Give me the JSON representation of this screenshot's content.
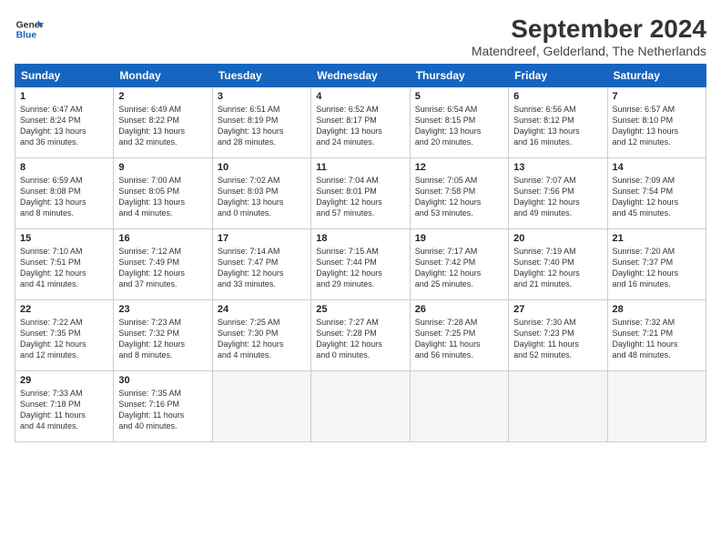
{
  "logo": {
    "line1": "General",
    "line2": "Blue"
  },
  "title": "September 2024",
  "subtitle": "Matendreef, Gelderland, The Netherlands",
  "headers": [
    "Sunday",
    "Monday",
    "Tuesday",
    "Wednesday",
    "Thursday",
    "Friday",
    "Saturday"
  ],
  "weeks": [
    [
      {
        "day": "1",
        "info": "Sunrise: 6:47 AM\nSunset: 8:24 PM\nDaylight: 13 hours\nand 36 minutes."
      },
      {
        "day": "2",
        "info": "Sunrise: 6:49 AM\nSunset: 8:22 PM\nDaylight: 13 hours\nand 32 minutes."
      },
      {
        "day": "3",
        "info": "Sunrise: 6:51 AM\nSunset: 8:19 PM\nDaylight: 13 hours\nand 28 minutes."
      },
      {
        "day": "4",
        "info": "Sunrise: 6:52 AM\nSunset: 8:17 PM\nDaylight: 13 hours\nand 24 minutes."
      },
      {
        "day": "5",
        "info": "Sunrise: 6:54 AM\nSunset: 8:15 PM\nDaylight: 13 hours\nand 20 minutes."
      },
      {
        "day": "6",
        "info": "Sunrise: 6:56 AM\nSunset: 8:12 PM\nDaylight: 13 hours\nand 16 minutes."
      },
      {
        "day": "7",
        "info": "Sunrise: 6:57 AM\nSunset: 8:10 PM\nDaylight: 13 hours\nand 12 minutes."
      }
    ],
    [
      {
        "day": "8",
        "info": "Sunrise: 6:59 AM\nSunset: 8:08 PM\nDaylight: 13 hours\nand 8 minutes."
      },
      {
        "day": "9",
        "info": "Sunrise: 7:00 AM\nSunset: 8:05 PM\nDaylight: 13 hours\nand 4 minutes."
      },
      {
        "day": "10",
        "info": "Sunrise: 7:02 AM\nSunset: 8:03 PM\nDaylight: 13 hours\nand 0 minutes."
      },
      {
        "day": "11",
        "info": "Sunrise: 7:04 AM\nSunset: 8:01 PM\nDaylight: 12 hours\nand 57 minutes."
      },
      {
        "day": "12",
        "info": "Sunrise: 7:05 AM\nSunset: 7:58 PM\nDaylight: 12 hours\nand 53 minutes."
      },
      {
        "day": "13",
        "info": "Sunrise: 7:07 AM\nSunset: 7:56 PM\nDaylight: 12 hours\nand 49 minutes."
      },
      {
        "day": "14",
        "info": "Sunrise: 7:09 AM\nSunset: 7:54 PM\nDaylight: 12 hours\nand 45 minutes."
      }
    ],
    [
      {
        "day": "15",
        "info": "Sunrise: 7:10 AM\nSunset: 7:51 PM\nDaylight: 12 hours\nand 41 minutes."
      },
      {
        "day": "16",
        "info": "Sunrise: 7:12 AM\nSunset: 7:49 PM\nDaylight: 12 hours\nand 37 minutes."
      },
      {
        "day": "17",
        "info": "Sunrise: 7:14 AM\nSunset: 7:47 PM\nDaylight: 12 hours\nand 33 minutes."
      },
      {
        "day": "18",
        "info": "Sunrise: 7:15 AM\nSunset: 7:44 PM\nDaylight: 12 hours\nand 29 minutes."
      },
      {
        "day": "19",
        "info": "Sunrise: 7:17 AM\nSunset: 7:42 PM\nDaylight: 12 hours\nand 25 minutes."
      },
      {
        "day": "20",
        "info": "Sunrise: 7:19 AM\nSunset: 7:40 PM\nDaylight: 12 hours\nand 21 minutes."
      },
      {
        "day": "21",
        "info": "Sunrise: 7:20 AM\nSunset: 7:37 PM\nDaylight: 12 hours\nand 16 minutes."
      }
    ],
    [
      {
        "day": "22",
        "info": "Sunrise: 7:22 AM\nSunset: 7:35 PM\nDaylight: 12 hours\nand 12 minutes."
      },
      {
        "day": "23",
        "info": "Sunrise: 7:23 AM\nSunset: 7:32 PM\nDaylight: 12 hours\nand 8 minutes."
      },
      {
        "day": "24",
        "info": "Sunrise: 7:25 AM\nSunset: 7:30 PM\nDaylight: 12 hours\nand 4 minutes."
      },
      {
        "day": "25",
        "info": "Sunrise: 7:27 AM\nSunset: 7:28 PM\nDaylight: 12 hours\nand 0 minutes."
      },
      {
        "day": "26",
        "info": "Sunrise: 7:28 AM\nSunset: 7:25 PM\nDaylight: 11 hours\nand 56 minutes."
      },
      {
        "day": "27",
        "info": "Sunrise: 7:30 AM\nSunset: 7:23 PM\nDaylight: 11 hours\nand 52 minutes."
      },
      {
        "day": "28",
        "info": "Sunrise: 7:32 AM\nSunset: 7:21 PM\nDaylight: 11 hours\nand 48 minutes."
      }
    ],
    [
      {
        "day": "29",
        "info": "Sunrise: 7:33 AM\nSunset: 7:18 PM\nDaylight: 11 hours\nand 44 minutes."
      },
      {
        "day": "30",
        "info": "Sunrise: 7:35 AM\nSunset: 7:16 PM\nDaylight: 11 hours\nand 40 minutes."
      },
      {
        "day": "",
        "info": ""
      },
      {
        "day": "",
        "info": ""
      },
      {
        "day": "",
        "info": ""
      },
      {
        "day": "",
        "info": ""
      },
      {
        "day": "",
        "info": ""
      }
    ]
  ]
}
